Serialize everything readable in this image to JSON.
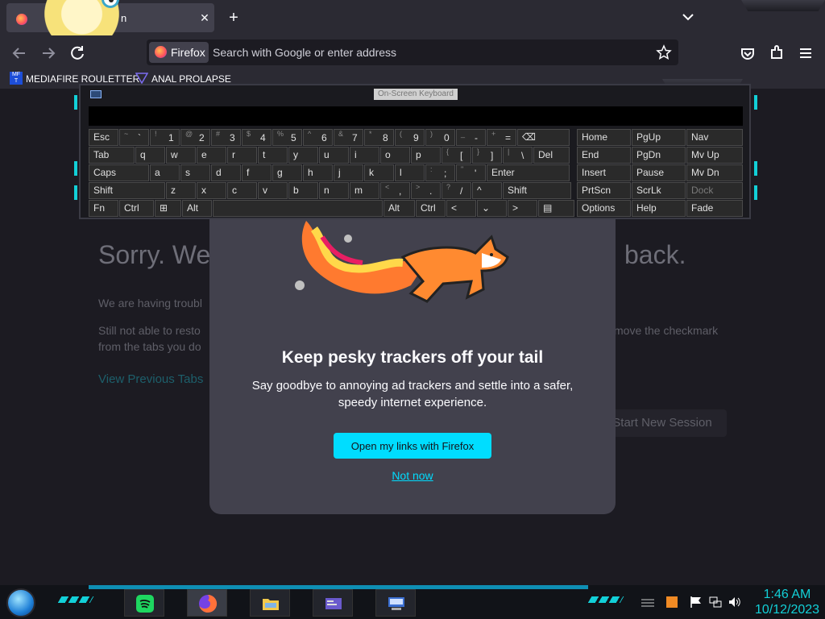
{
  "browser": {
    "tab": {
      "title": "n",
      "close_glyph": "✕"
    },
    "new_tab_glyph": "+",
    "identity_label": "Firefox",
    "url_placeholder": "Search with Google or enter address"
  },
  "bookmarks": [
    {
      "label": "MEDIAFIRE ROULETTER",
      "icon_text": "MF T"
    },
    {
      "label": "ANAL PROLAPSE"
    }
  ],
  "session_restore": {
    "title_left": "Sorry. We’",
    "title_right": "back.",
    "para1": "We are having troubl",
    "para2_left": "Still not able to resto",
    "para2_right": "move the checkmark",
    "para3": "from the tabs you do",
    "view_tabs_link": "View Previous Tabs",
    "start_new_session": "Start New Session"
  },
  "modal": {
    "title": "Keep pesky trackers off your tail",
    "body": "Say goodbye to annoying ad trackers and settle into a safer, speedy internet experience.",
    "primary_button": "Open my links with Firefox",
    "secondary_link": "Not now"
  },
  "osk": {
    "title": "On-Screen Keyboard",
    "rows": [
      [
        {
          "l": "Esc",
          "w": 38
        },
        {
          "s": "~",
          "l": "`",
          "w": 38
        },
        {
          "s": "!",
          "l": "1",
          "w": 38
        },
        {
          "s": "@",
          "l": "2",
          "w": 38
        },
        {
          "s": "#",
          "l": "3",
          "w": 38
        },
        {
          "s": "$",
          "l": "4",
          "w": 38
        },
        {
          "s": "%",
          "l": "5",
          "w": 38
        },
        {
          "s": "^",
          "l": "6",
          "w": 38
        },
        {
          "s": "&",
          "l": "7",
          "w": 38
        },
        {
          "s": "*",
          "l": "8",
          "w": 38
        },
        {
          "s": "(",
          "l": "9",
          "w": 38
        },
        {
          "s": ")",
          "l": "0",
          "w": 38
        },
        {
          "s": "_",
          "l": "-",
          "w": 38
        },
        {
          "s": "+",
          "l": "=",
          "w": 38
        },
        {
          "l": "⌫",
          "w": 66
        }
      ],
      [
        {
          "l": "Tab",
          "w": 58
        },
        {
          "l": "q",
          "w": 38
        },
        {
          "l": "w",
          "w": 38
        },
        {
          "l": "e",
          "w": 38
        },
        {
          "l": "r",
          "w": 38
        },
        {
          "l": "t",
          "w": 38
        },
        {
          "l": "y",
          "w": 38
        },
        {
          "l": "u",
          "w": 38
        },
        {
          "l": "i",
          "w": 38
        },
        {
          "l": "o",
          "w": 38
        },
        {
          "l": "p",
          "w": 38
        },
        {
          "s": "{",
          "l": "[",
          "w": 38
        },
        {
          "s": "}",
          "l": "]",
          "w": 38
        },
        {
          "s": "|",
          "l": "\\",
          "w": 38
        },
        {
          "l": "Del",
          "w": 46
        }
      ],
      [
        {
          "l": "Caps",
          "w": 76
        },
        {
          "l": "a",
          "w": 38
        },
        {
          "l": "s",
          "w": 38
        },
        {
          "l": "d",
          "w": 38
        },
        {
          "l": "f",
          "w": 38
        },
        {
          "l": "g",
          "w": 38
        },
        {
          "l": "h",
          "w": 38
        },
        {
          "l": "j",
          "w": 38
        },
        {
          "l": "k",
          "w": 38
        },
        {
          "l": "l",
          "w": 38
        },
        {
          "s": ":",
          "l": ";",
          "w": 38
        },
        {
          "s": "\"",
          "l": "'",
          "w": 38
        },
        {
          "l": "Enter",
          "w": 104
        }
      ],
      [
        {
          "l": "Shift",
          "w": 96
        },
        {
          "l": "z",
          "w": 38
        },
        {
          "l": "x",
          "w": 38
        },
        {
          "l": "c",
          "w": 38
        },
        {
          "l": "v",
          "w": 38
        },
        {
          "l": "b",
          "w": 38
        },
        {
          "l": "n",
          "w": 38
        },
        {
          "l": "m",
          "w": 38
        },
        {
          "s": "<",
          "l": ",",
          "w": 38
        },
        {
          "s": ">",
          "l": ".",
          "w": 38
        },
        {
          "s": "?",
          "l": "/",
          "w": 38
        },
        {
          "l": "^",
          "w": 38
        },
        {
          "l": "Shift",
          "w": 86
        }
      ],
      [
        {
          "l": "Fn",
          "w": 38
        },
        {
          "l": "Ctrl",
          "w": 44
        },
        {
          "l": "⊞",
          "w": 34
        },
        {
          "l": "Alt",
          "w": 38
        },
        {
          "l": "",
          "w": 212
        },
        {
          "l": "Alt",
          "w": 40
        },
        {
          "l": "Ctrl",
          "w": 38
        },
        {
          "l": "<",
          "w": 38
        },
        {
          "l": "⌄",
          "w": 38
        },
        {
          "l": ">",
          "w": 38
        },
        {
          "l": "▤",
          "w": 46
        }
      ]
    ],
    "nav_rows": [
      [
        {
          "l": "Home"
        },
        {
          "l": "PgUp"
        },
        {
          "l": "Nav"
        }
      ],
      [
        {
          "l": "End"
        },
        {
          "l": "PgDn"
        },
        {
          "l": "Mv Up"
        }
      ],
      [
        {
          "l": "Insert"
        },
        {
          "l": "Pause"
        },
        {
          "l": "Mv Dn"
        }
      ],
      [
        {
          "l": "PrtScn"
        },
        {
          "l": "ScrLk"
        },
        {
          "l": "Dock",
          "dim": true
        }
      ],
      [
        {
          "l": "Options"
        },
        {
          "l": "Help"
        },
        {
          "l": "Fade"
        }
      ]
    ]
  },
  "taskbar": {
    "time": "1:46 AM",
    "date": "10/12/2023",
    "accent": "#12d0d8"
  }
}
